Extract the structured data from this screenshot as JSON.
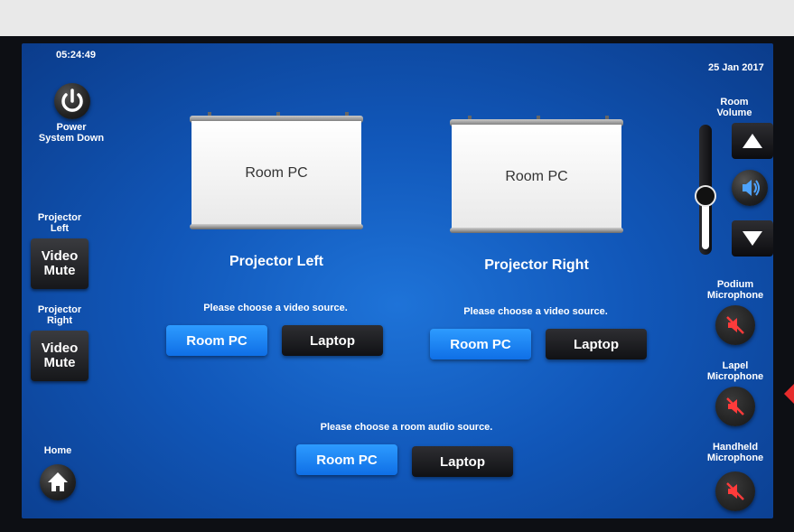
{
  "header": {
    "time": "05:24:49",
    "date": "25 Jan 2017"
  },
  "power": {
    "label": "Power System Down"
  },
  "left_panel": {
    "projector_left_label": "Projector Left",
    "projector_right_label": "Projector Right",
    "video_mute_label": "Video Mute",
    "home_label": "Home"
  },
  "projectors": [
    {
      "title": "Projector Left",
      "screen_text": "Room PC",
      "prompt": "Please choose a video source.",
      "sources": [
        "Room PC",
        "Laptop"
      ],
      "selected": "Room PC"
    },
    {
      "title": "Projector Right",
      "screen_text": "Room PC",
      "prompt": "Please choose a video source.",
      "sources": [
        "Room PC",
        "Laptop"
      ],
      "selected": "Room PC"
    }
  ],
  "audio": {
    "prompt": "Please choose a room audio source.",
    "sources": [
      "Room PC",
      "Laptop"
    ],
    "selected": "Room PC"
  },
  "volume": {
    "label": "Room Volume",
    "level": 0.45,
    "icons": [
      "volume-up-icon",
      "speaker-icon",
      "volume-down-icon"
    ]
  },
  "mics": [
    {
      "label": "Podium Microphone",
      "state": "muted"
    },
    {
      "label": "Lapel Microphone",
      "state": "muted"
    },
    {
      "label": "Handheld Microphone",
      "state": "muted"
    }
  ],
  "colors": {
    "screen_bg": "#1157b9",
    "active_button": "#1f86f5",
    "inactive_button": "#1a1b1e",
    "mute_icon": "#ff3b3b",
    "indicator": "#e62b2b"
  }
}
